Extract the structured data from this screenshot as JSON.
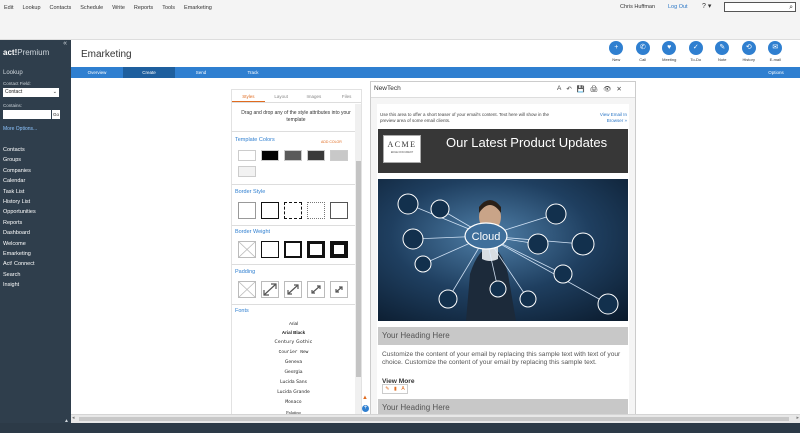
{
  "menu": [
    "Edit",
    "Lookup",
    "Contacts",
    "Schedule",
    "Write",
    "Reports",
    "Tools",
    "Emarketing"
  ],
  "user": {
    "name": "Chris Huffman",
    "logout": "Log Out"
  },
  "help": {
    "icon": "?",
    "chevron": "▾"
  },
  "search_icon": "⌕",
  "brand": {
    "name": "act!",
    "edition": "Premium",
    "collapse": "«"
  },
  "sidebar": {
    "lookup_title": "Lookup",
    "contact_field_label": "Contact Field:",
    "contact_field_value": "Contact",
    "contains_label": "Contains:",
    "go_label": "Go",
    "more_options": "More Options...",
    "nav": [
      "Contacts",
      "Groups",
      "Companies",
      "Calendar",
      "Task List",
      "History List",
      "Opportunities",
      "Reports",
      "Dashboard",
      "Welcome",
      "Emarketing",
      "Act! Connect",
      "Search",
      "Insight"
    ],
    "scroll_glyph": "▲"
  },
  "header": {
    "title": "Emarketing"
  },
  "toolbar": [
    {
      "label": "New",
      "icon": "+"
    },
    {
      "label": "Call",
      "icon": "✆"
    },
    {
      "label": "Meeting",
      "icon": "♥"
    },
    {
      "label": "To-Do",
      "icon": "✓"
    },
    {
      "label": "Note",
      "icon": "✎"
    },
    {
      "label": "History",
      "icon": "⟲"
    },
    {
      "label": "E-mail",
      "icon": "✉"
    }
  ],
  "tabs": [
    "Overview",
    "Create",
    "Send",
    "Track",
    "Options"
  ],
  "style_panel": {
    "tabs": [
      "Styles",
      "Layout",
      "Images",
      "Files"
    ],
    "description": "Drag and drop any of the style attributes into your template",
    "template_colors": "Template Colors",
    "add_color": "ADD COLOR",
    "border_style": "Border Style",
    "border_weight": "Border Weight",
    "padding": "Padding",
    "fonts_title": "Fonts",
    "fonts": [
      "Arial",
      "Arial Black",
      "Century Gothic",
      "Courier New",
      "Geneva",
      "Georgia",
      "Lucida Sans",
      "Lucida Grande",
      "Monaco",
      "Palatino"
    ]
  },
  "colors": {
    "swatches": [
      "#ffffff",
      "#000000",
      "#5a5a5a",
      "#3a3a3a",
      "#c8c8c8",
      "#f2f2f2"
    ],
    "accent": "#2f7fd0",
    "orange": "#e06b1f",
    "sidebar": "#2f3e4c"
  },
  "editor": {
    "name": "NewTech",
    "tools": [
      "A",
      "↶",
      "💾",
      "🖨",
      "👁",
      "✕"
    ],
    "preheader": "Use this area to offer a short teaser of your email's content. Text here will show in the preview area of some email clients.",
    "view_link": "View Email In Browser »",
    "logo_main": "ACME",
    "logo_sub": "EDGE DOCUMENT",
    "banner_title": "Our Latest Product Updates",
    "hero_cloud": "Cloud",
    "heading": "Your Heading Here",
    "body": "Customize the content of your email by replacing this sample text with text of your choice. Customize the content of your email by replacing this sample text.",
    "view_more": "View More",
    "heading2": "Your Heading Here",
    "inline_tools": [
      "✎",
      "▮",
      "A"
    ]
  },
  "side_arrows": {
    "up": "▲",
    "plus": "+"
  },
  "hscroll": {
    "left": "◂",
    "right": "▸"
  }
}
